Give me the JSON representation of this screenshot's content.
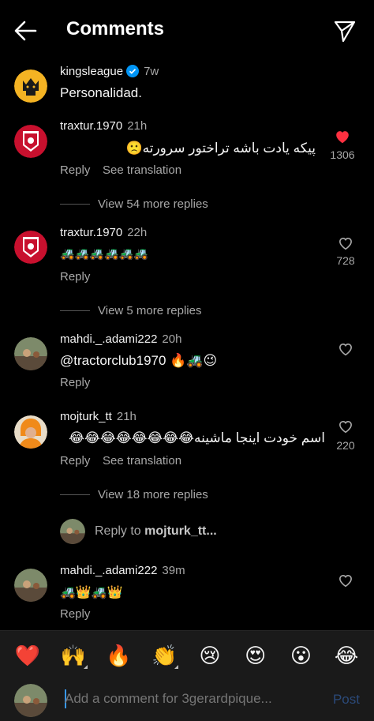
{
  "header": {
    "title": "Comments",
    "back_icon": "arrow-left-icon",
    "share_icon": "paper-plane-icon"
  },
  "caption": {
    "username": "kingsleague",
    "time": "7w",
    "text": "Personalidad."
  },
  "comments": [
    {
      "username": "traxtur.1970",
      "time": "21h",
      "text": "پیکه یادت باشه تراختور سرورته🙁",
      "reply_label": "Reply",
      "translate_label": "See translation",
      "likes": "1306",
      "liked": true,
      "view_replies": "View 54 more replies"
    },
    {
      "username": "traxtur.1970",
      "time": "22h",
      "text": "🚜🚜🚜🚜🚜🚜",
      "reply_label": "Reply",
      "likes": "728",
      "liked": false,
      "view_replies": "View 5 more replies"
    },
    {
      "username": "mahdi._.adami222",
      "time": "20h",
      "text": "@tractorclub1970 🔥🚜😉",
      "reply_label": "Reply",
      "likes": "",
      "liked": false
    },
    {
      "username": "mojturk_tt",
      "time": "21h",
      "text": "اسم خودت اینجا ماشینه😂😂😂😂😂😂😂😂",
      "reply_label": "Reply",
      "translate_label": "See translation",
      "likes": "220",
      "liked": false,
      "view_replies": "View 18 more replies"
    },
    {
      "username": "mahdi._.adami222",
      "time": "39m",
      "text": "🚜👑🚜👑",
      "reply_label": "Reply",
      "likes": "",
      "liked": false
    }
  ],
  "reply_to": {
    "prefix": "Reply to ",
    "user": "mojturk_tt..."
  },
  "emoji_bar": [
    "❤️",
    "🙌",
    "🔥",
    "👏",
    "😢",
    "😍",
    "😮",
    "😂"
  ],
  "composer": {
    "placeholder": "Add a comment for 3gerardpique...",
    "post_label": "Post"
  },
  "colors": {
    "like_red": "#ff3040",
    "muted": "#a8a8a8",
    "post_disabled": "#2b4a7a",
    "verified_blue": "#0095f6"
  }
}
